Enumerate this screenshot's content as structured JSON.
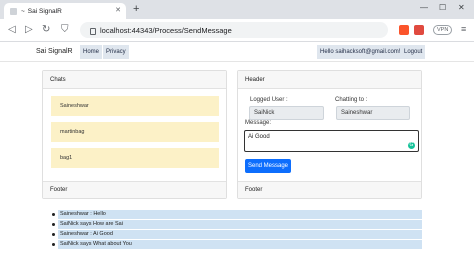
{
  "browser": {
    "tab_title": "Sai SignalR",
    "tab_prefix": "~",
    "url": "localhost:44343/Process/SendMessage",
    "vpn_label": "VPN"
  },
  "navbar": {
    "brand": "Sai SignalR",
    "links": [
      "Home",
      "Privacy"
    ],
    "user_greeting": "Hello saihacksoft@gmail.com!",
    "logout": "Logout"
  },
  "chats_card": {
    "header": "Chats",
    "items": [
      "Saineshwar",
      "martinbag",
      "bag1"
    ],
    "footer": "Footer"
  },
  "message_card": {
    "header": "Header",
    "logged_user_label": "Logged User :",
    "logged_user_value": "SaiNick",
    "chatting_to_label": "Chatting to :",
    "chatting_to_value": "Saineshwar",
    "message_label": "Message:",
    "message_value": "Ai Good",
    "send_label": "Send Message",
    "footer": "Footer"
  },
  "messages": [
    "Saineshwar : Hello",
    "SaiNick says How are Sai",
    "Saineshwar : Ai Good",
    "SaiNick says What about You"
  ]
}
